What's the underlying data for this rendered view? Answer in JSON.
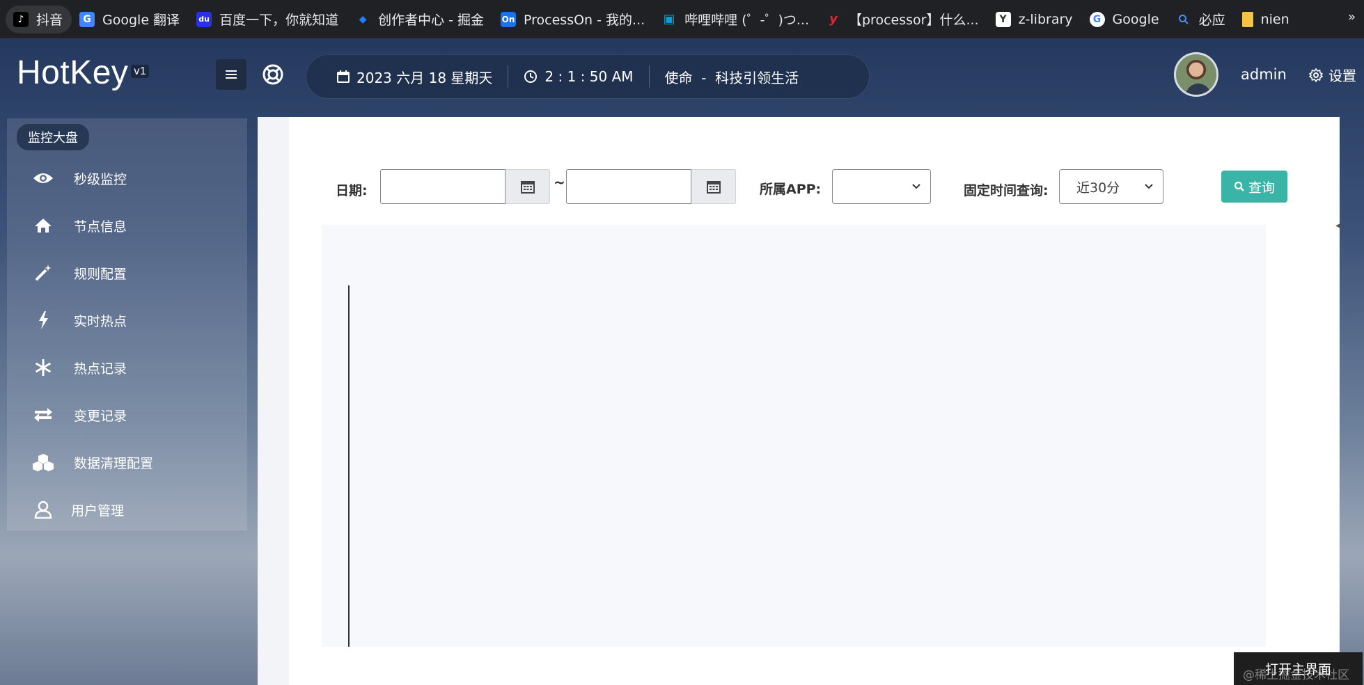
{
  "bookmarks": [
    {
      "label": "抖音",
      "icon": "tiktok-icon",
      "color": "#000000",
      "glyph": "♪",
      "active": true
    },
    {
      "label": "Google 翻译",
      "icon": "google-translate-icon",
      "color": "#4285f4",
      "glyph": "G"
    },
    {
      "label": "百度一下，你就知道",
      "icon": "baidu-icon",
      "color": "#2932e1",
      "glyph": "du"
    },
    {
      "label": "创作者中心 - 掘金",
      "icon": "juejin-icon",
      "color": "#1e80ff",
      "glyph": "◆"
    },
    {
      "label": "ProcessOn - 我的...",
      "icon": "processon-icon",
      "color": "#1a73e8",
      "glyph": "On"
    },
    {
      "label": "哔哩哔哩 (゜-゜)つ...",
      "icon": "bilibili-icon",
      "color": "#00a1d6",
      "glyph": "▣"
    },
    {
      "label": "【processor】什么...",
      "icon": "youdao-icon",
      "color": "#e0252e",
      "glyph": "y"
    },
    {
      "label": "z-library",
      "icon": "zlibrary-icon",
      "color": "#ffffff",
      "glyph": "Y"
    },
    {
      "label": "Google",
      "icon": "google-icon",
      "color": "#ffffff",
      "glyph": "G"
    },
    {
      "label": "必应",
      "icon": "bing-search-icon",
      "color": "#1a73e8",
      "glyph": "🔍"
    },
    {
      "label": "nien",
      "icon": "folder-note-icon",
      "color": "#f6c343",
      "glyph": ""
    }
  ],
  "bookmarks_more": "»",
  "app": {
    "logo": "HotKey",
    "version": "v1",
    "date": "2023 六月 18 星期天",
    "time": "2 : 1 : 50 AM",
    "mission": "使命  -  科技引领生活",
    "user": "admin",
    "settings": "设置"
  },
  "sidebar": {
    "header": "监控大盘",
    "items": [
      {
        "label": "秒级监控",
        "icon": "eye-icon"
      },
      {
        "label": "节点信息",
        "icon": "home-icon"
      },
      {
        "label": "规则配置",
        "icon": "magic-wand-icon"
      },
      {
        "label": "实时热点",
        "icon": "bolt-icon"
      },
      {
        "label": "热点记录",
        "icon": "snowflake-icon"
      },
      {
        "label": "变更记录",
        "icon": "exchange-icon"
      },
      {
        "label": "数据清理配置",
        "icon": "cubes-icon"
      },
      {
        "label": "用户管理",
        "icon": "user-icon"
      }
    ]
  },
  "filters": {
    "date_label": "日期:",
    "date_start": "",
    "date_end": "",
    "separator": "~",
    "app_label": "所属APP:",
    "app_value": "",
    "fixed_label": "固定时间查询:",
    "fixed_value": "近30分",
    "query_button": "查询"
  },
  "toast": "打开主界面",
  "watermark": "@稀土掘金技术社区",
  "colors": {
    "accent": "#3bb4a8",
    "topbar": "#203150"
  }
}
